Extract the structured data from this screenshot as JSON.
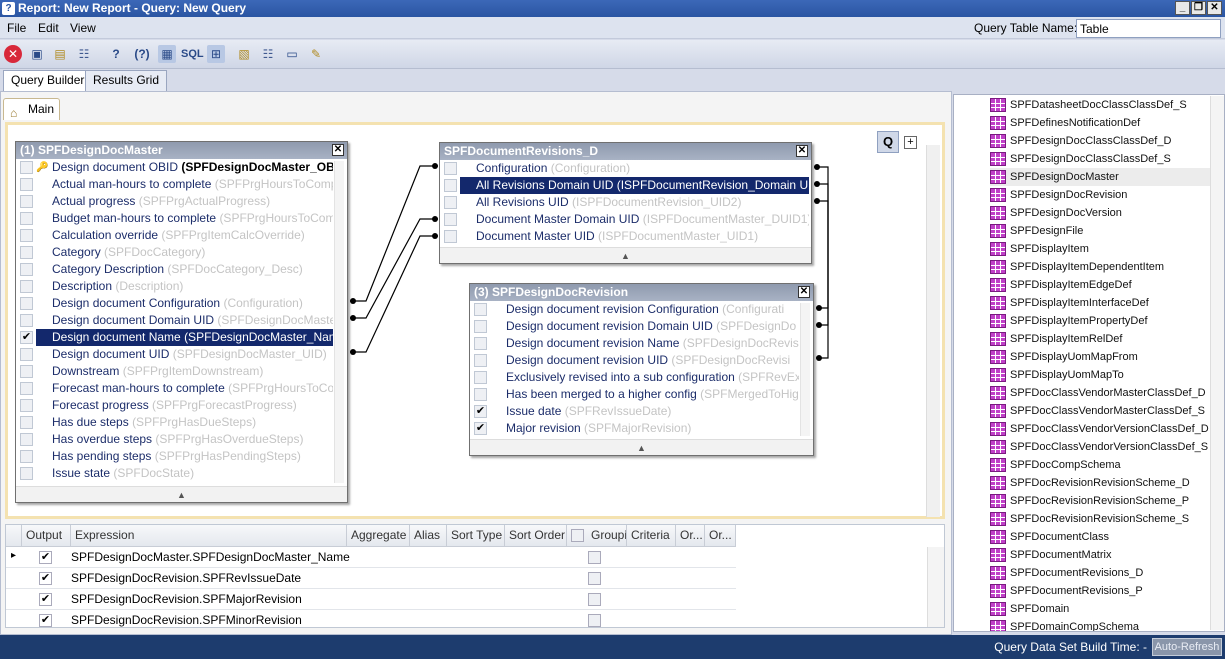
{
  "window": {
    "title": "Report: New Report - Query: New Query"
  },
  "menu": {
    "items": [
      "File",
      "Edit",
      "View"
    ],
    "query_table_label": "Query Table Name:",
    "query_table_value": "Table"
  },
  "toolbar": {
    "icons": [
      "close-red-icon",
      "save-icon",
      "open-icon",
      "properties-icon",
      "help-icon",
      "help-query-icon",
      "grid-view-icon",
      "sql-icon",
      "tables-icon",
      "export-icon",
      "import-icon",
      "layout-icon",
      "edit-icon"
    ],
    "sql_label": "SQL"
  },
  "tabs": {
    "query_builder": "Query Builder",
    "results_grid": "Results Grid"
  },
  "canvas": {
    "main_tab": "Main",
    "q_button": "Q",
    "plus_button": "+"
  },
  "tables": [
    {
      "header": "(1) SPFDesignDocMaster",
      "rows": [
        {
          "label": "Design document OBID",
          "alias": "(SPFDesignDocMaster_OBID)",
          "checked": false,
          "key": true,
          "alias_bold": true
        },
        {
          "label": "Actual man-hours to complete",
          "alias": "(SPFPrgHoursToComp",
          "checked": false
        },
        {
          "label": "Actual progress",
          "alias": "(SPFPrgActualProgress)",
          "checked": false
        },
        {
          "label": "Budget man-hours to complete",
          "alias": "(SPFPrgHoursToCom",
          "checked": false
        },
        {
          "label": "Calculation override",
          "alias": "(SPFPrgItemCalcOverride)",
          "checked": false
        },
        {
          "label": "Category",
          "alias": "(SPFDocCategory)",
          "checked": false
        },
        {
          "label": "Category Description",
          "alias": "(SPFDocCategory_Desc)",
          "checked": false
        },
        {
          "label": "Description",
          "alias": "(Description)",
          "checked": false
        },
        {
          "label": "Design document Configuration",
          "alias": "(Configuration)",
          "checked": false
        },
        {
          "label": "Design document Domain UID",
          "alias": "(SPFDesignDocMaste",
          "checked": false
        },
        {
          "label": "Design document Name (SPFDesignDocMaster_Nam",
          "alias": "",
          "checked": true,
          "selected": true
        },
        {
          "label": "Design document UID",
          "alias": "(SPFDesignDocMaster_UID)",
          "checked": false
        },
        {
          "label": "Downstream",
          "alias": "(SPFPrgItemDownstream)",
          "checked": false
        },
        {
          "label": "Forecast man-hours to complete",
          "alias": "(SPFPrgHoursToCo",
          "checked": false
        },
        {
          "label": "Forecast progress",
          "alias": "(SPFPrgForecastProgress)",
          "checked": false
        },
        {
          "label": "Has due steps",
          "alias": "(SPFPrgHasDueSteps)",
          "checked": false
        },
        {
          "label": "Has overdue steps",
          "alias": "(SPFPrgHasOverdueSteps)",
          "checked": false
        },
        {
          "label": "Has pending steps",
          "alias": "(SPFPrgHasPendingSteps)",
          "checked": false
        },
        {
          "label": "Issue state",
          "alias": "(SPFDocState)",
          "checked": false
        }
      ]
    },
    {
      "header": "SPFDocumentRevisions_D",
      "rows": [
        {
          "label": "Configuration",
          "alias": "(Configuration)",
          "checked": false
        },
        {
          "label": "All Revisions Domain UID (ISPFDocumentRevision_Domain UI",
          "alias": "",
          "checked": false,
          "selected": true
        },
        {
          "label": "All Revisions UID",
          "alias": "(ISPFDocumentRevision_UID2)",
          "checked": false
        },
        {
          "label": "Document Master Domain UID",
          "alias": "(ISPFDocumentMaster_DUID1)",
          "checked": false
        },
        {
          "label": "Document Master UID",
          "alias": "(ISPFDocumentMaster_UID1)",
          "checked": false
        }
      ]
    },
    {
      "header": "(3) SPFDesignDocRevision",
      "rows": [
        {
          "label": "Design document revision Configuration",
          "alias": "(Configurati",
          "checked": false
        },
        {
          "label": "Design document revision Domain UID",
          "alias": "(SPFDesignDo",
          "checked": false
        },
        {
          "label": "Design document revision Name",
          "alias": "(SPFDesignDocRevisi",
          "checked": false
        },
        {
          "label": "Design document revision UID",
          "alias": "(SPFDesignDocRevisi",
          "checked": false
        },
        {
          "label": "Exclusively revised into a sub configuration",
          "alias": "(SPFRevEx",
          "checked": false
        },
        {
          "label": "Has been merged to a higher config",
          "alias": "(SPFMergedToHig",
          "checked": false
        },
        {
          "label": "Issue date",
          "alias": "(SPFRevIssueDate)",
          "checked": true
        },
        {
          "label": "Major revision",
          "alias": "(SPFMajorRevision)",
          "checked": true
        }
      ]
    }
  ],
  "grid": {
    "headers": [
      "Output",
      "Expression",
      "Aggregate",
      "Alias",
      "Sort Type",
      "Sort Order",
      "Groupi",
      "Criteria",
      "Or...",
      "Or..."
    ],
    "rows": [
      {
        "output": true,
        "expression": "SPFDesignDocMaster.SPFDesignDocMaster_Name",
        "current": true
      },
      {
        "output": true,
        "expression": "SPFDesignDocRevision.SPFRevIssueDate"
      },
      {
        "output": true,
        "expression": "SPFDesignDocRevision.SPFMajorRevision"
      },
      {
        "output": true,
        "expression": "SPFDesignDocRevision.SPFMinorRevision"
      }
    ]
  },
  "tree": {
    "items": [
      "SPFDatasheetDocClassClassDef_S",
      "SPFDefinesNotificationDef",
      "SPFDesignDocClassClassDef_D",
      "SPFDesignDocClassClassDef_S",
      "SPFDesignDocMaster",
      "SPFDesignDocRevision",
      "SPFDesignDocVersion",
      "SPFDesignFile",
      "SPFDisplayItem",
      "SPFDisplayItemDependentItem",
      "SPFDisplayItemEdgeDef",
      "SPFDisplayItemInterfaceDef",
      "SPFDisplayItemPropertyDef",
      "SPFDisplayItemRelDef",
      "SPFDisplayUomMapFrom",
      "SPFDisplayUomMapTo",
      "SPFDocClassVendorMasterClassDef_D",
      "SPFDocClassVendorMasterClassDef_S",
      "SPFDocClassVendorVersionClassDef_D",
      "SPFDocClassVendorVersionClassDef_S",
      "SPFDocCompSchema",
      "SPFDocRevisionRevisionScheme_D",
      "SPFDocRevisionRevisionScheme_P",
      "SPFDocRevisionRevisionScheme_S",
      "SPFDocumentClass",
      "SPFDocumentMatrix",
      "SPFDocumentRevisions_D",
      "SPFDocumentRevisions_P",
      "SPFDomain",
      "SPFDomainCompSchema"
    ],
    "selected": "SPFDesignDocMaster"
  },
  "status": {
    "label": "Query Data Set Build Time: -",
    "auto_refresh": "Auto-Refresh"
  }
}
